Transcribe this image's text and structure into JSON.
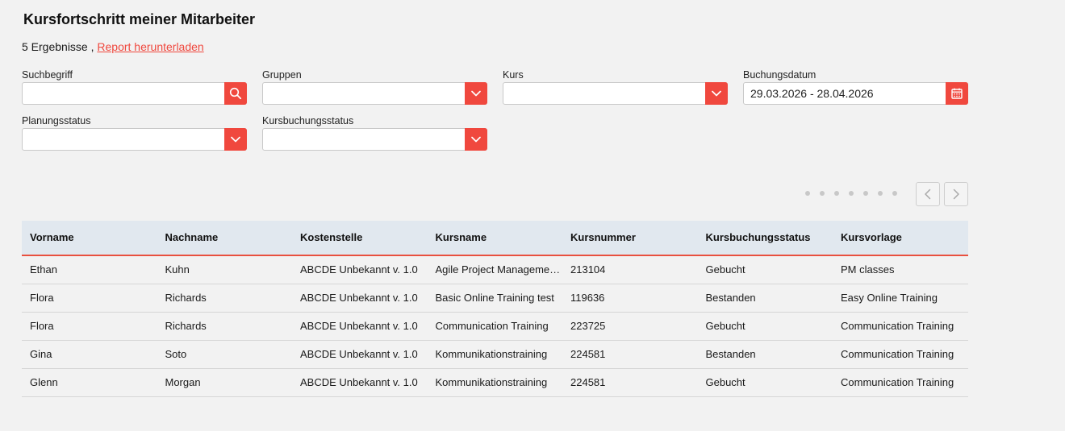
{
  "page": {
    "title": "Kursfortschritt meiner Mitarbeiter",
    "results_count": "5 Ergebnisse ,",
    "download_link": "Report herunterladen"
  },
  "filters": {
    "search": {
      "label": "Suchbegriff",
      "value": "",
      "icon": "search-icon"
    },
    "groups": {
      "label": "Gruppen",
      "value": "",
      "icon": "chevron-down-icon"
    },
    "course": {
      "label": "Kurs",
      "value": "",
      "icon": "chevron-down-icon"
    },
    "booking_date": {
      "label": "Buchungsdatum",
      "value": "29.03.2026 - 28.04.2026",
      "icon": "calendar-icon"
    },
    "planning_status": {
      "label": "Planungsstatus",
      "value": "",
      "icon": "chevron-down-icon"
    },
    "booking_status": {
      "label": "Kursbuchungsstatus",
      "value": "",
      "icon": "chevron-down-icon"
    }
  },
  "colors": {
    "accent": "#f0483e",
    "header_bg": "#e1e8ef",
    "page_bg": "#f2f2f2"
  },
  "table": {
    "columns": [
      "Vorname",
      "Nachname",
      "Kostenstelle",
      "Kursname",
      "Kursnummer",
      "Kursbuchungsstatus",
      "Kursvorlage"
    ],
    "rows": [
      [
        "Ethan",
        "Kuhn",
        "ABCDE Unbekannt v. 1.0",
        "Agile Project Manageme…",
        "213104",
        "Gebucht",
        "PM classes"
      ],
      [
        "Flora",
        "Richards",
        "ABCDE Unbekannt v. 1.0",
        "Basic Online Training test",
        "119636",
        "Bestanden",
        "Easy Online Training"
      ],
      [
        "Flora",
        "Richards",
        "ABCDE Unbekannt v. 1.0",
        "Communication Training",
        "223725",
        "Gebucht",
        "Communication Training"
      ],
      [
        "Gina",
        "Soto",
        "ABCDE Unbekannt v. 1.0",
        "Kommunikationstraining",
        "224581",
        "Bestanden",
        "Communication Training"
      ],
      [
        "Glenn",
        "Morgan",
        "ABCDE Unbekannt v. 1.0",
        "Kommunikationstraining",
        "224581",
        "Gebucht",
        "Communication Training"
      ]
    ]
  }
}
